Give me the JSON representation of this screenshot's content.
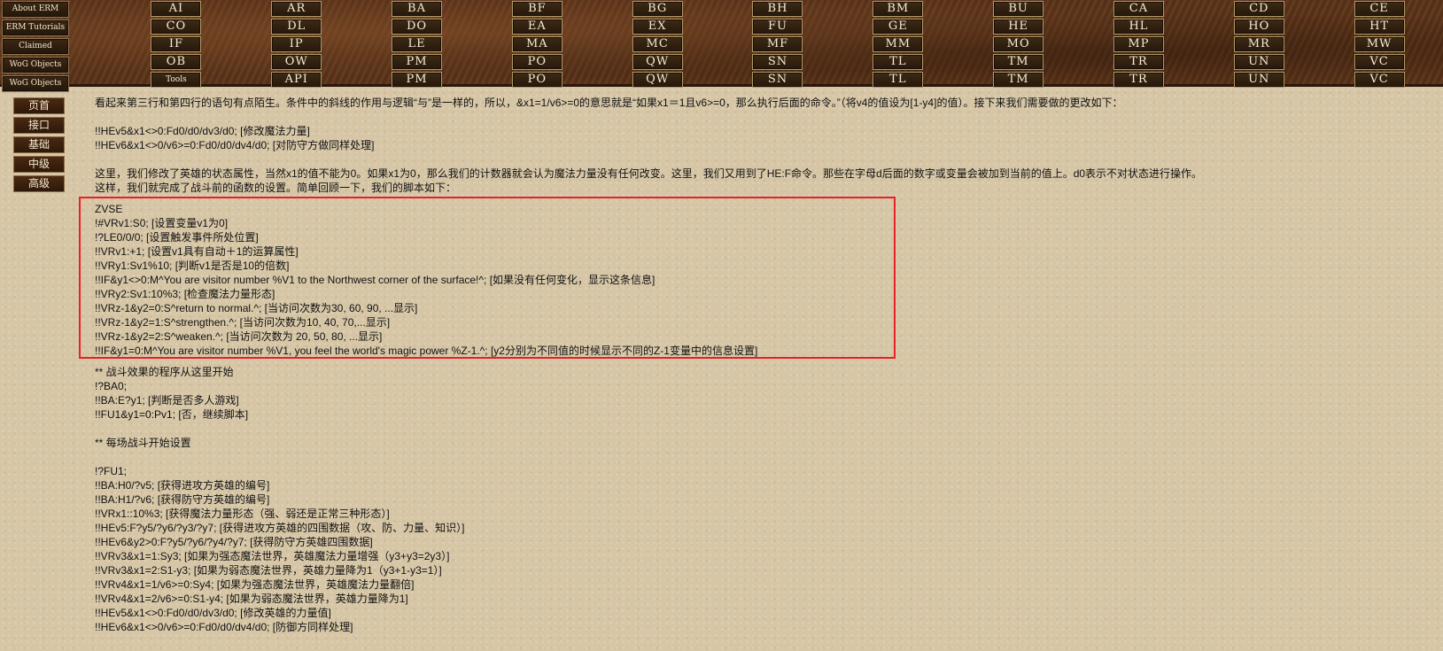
{
  "top_left_nav": [
    "About ERM",
    "ERM Tutorials",
    "Claimed",
    "WoG Objects",
    "WoG Objects"
  ],
  "top_grid": [
    [
      "AI",
      "AR",
      "BA",
      "BF",
      "BG",
      "BH",
      "BM",
      "BU",
      "CA",
      "CD",
      "CE"
    ],
    [
      "CO",
      "DL",
      "DO",
      "EA",
      "EX",
      "FU",
      "GE",
      "HE",
      "HL",
      "HO",
      "HT"
    ],
    [
      "IF",
      "IP",
      "LE",
      "MA",
      "MC",
      "MF",
      "MM",
      "MO",
      "MP",
      "MR",
      "MW"
    ],
    [
      "OB",
      "OW",
      "PM",
      "PO",
      "QW",
      "SN",
      "TL",
      "TM",
      "TR",
      "UN",
      "VC"
    ],
    [
      "Tools",
      "API",
      "PM",
      "PO",
      "QW",
      "SN",
      "TL",
      "TM",
      "TR",
      "UN",
      "VC"
    ]
  ],
  "side_nav": [
    "页首",
    "接口",
    "基础",
    "中级",
    "高级"
  ],
  "intro": {
    "p1": "看起来第三行和第四行的语句有点陌生。条件中的斜线的作用与逻辑“与”是一样的，所以，&x1=1/v6>=0的意思就是“如果x1＝1且v6>=0，那么执行后面的命令。”（将v4的值设为[1-y4]的值）。接下来我们需要做的更改如下：",
    "l1": "!!HEv5&x1<>0:Fd0/d0/dv3/d0; [修改魔法力量]",
    "l2": "!!HEv6&x1<>0/v6>=0:Fd0/d0/dv4/d0;  [对防守方做同样处理]",
    "p2": "这里，我们修改了英雄的状态属性，当然x1的值不能为0。如果x1为0，那么我们的计数器就会认为魔法力量没有任何改变。这里，我们又用到了HE:F命令。那些在字母d后面的数字或变量会被加到当前的值上。d0表示不对状态进行操作。",
    "p3": "这样，我们就完成了战斗前的函数的设置。简单回顾一下，我们的脚本如下："
  },
  "code_box": [
    "ZVSE",
    "!#VRv1:S0; [设置变量v1为0]",
    "!?LE0/0/0;  [设置触发事件所处位置]",
    "!!VRv1:+1;  [设置v1具有自动＋1的运算属性]",
    "!!VRy1:Sv1%10; [判断v1是否是10的倍数]",
    "!!IF&y1<>0:M^You are visitor number %V1 to the Northwest corner of the surface!^; [如果没有任何变化，显示这条信息]",
    "!!VRy2:Sv1:10%3; [检查魔法力量形态]",
    "!!VRz-1&y2=0:S^return to normal.^; [当访问次数为30, 60, 90, ...显示]",
    "!!VRz-1&y2=1:S^strengthen.^; [当访问次数为10, 40, 70,...显示]",
    "!!VRz-1&y2=2:S^weaken.^; [当访问次数为  20, 50, 80, ...显示]",
    "!!IF&y1=0:M^You are visitor number %V1, you feel the world's magic power %Z-1.^; [y2分别为不同值的时候显示不同的Z-1变量中的信息设置]"
  ],
  "after_lines": [
    "** 战斗效果的程序从这里开始",
    "!?BA0;",
    "!!BA:E?y1; [判断是否多人游戏]",
    "!!FU1&y1=0:Pv1; [否，继续脚本]",
    "",
    "** 每场战斗开始设置",
    "",
    "!?FU1;",
    "!!BA:H0/?v5; [获得进攻方英雄的编号]",
    "!!BA:H1/?v6; [获得防守方英雄的编号]",
    "!!VRx1::10%3; [获得魔法力量形态（强、弱还是正常三种形态）]",
    "!!HEv5:F?y5/?y6/?y3/?y7; [获得进攻方英雄的四围数据（攻、防、力量、知识）]",
    "!!HEv6&y2>0:F?y5/?y6/?y4/?y7; [获得防守方英雄四围数据]",
    "!!VRv3&x1=1:Sy3; [如果为强态魔法世界，英雄魔法力量增强（y3+y3=2y3）]",
    "!!VRv3&x1=2:S1-y3; [如果为弱态魔法世界，英雄力量降为1（y3+1-y3=1）]",
    "!!VRv4&x1=1/v6>=0:Sy4; [如果为强态魔法世界，英雄魔法力量翻倍]",
    "!!VRv4&x1=2/v6>=0:S1-y4; [如果为弱态魔法世界，英雄力量降为1]",
    "!!HEv5&x1<>0:Fd0/d0/dv3/d0; [修改英雄的力量值]",
    "!!HEv6&x1<>0/v6>=0:Fd0/d0/dv4/d0;  [防御方同样处理]"
  ],
  "colors": {
    "background": "#d6c6a6",
    "nav_wood": "#5a3218",
    "highlight_border": "#e8202a"
  }
}
